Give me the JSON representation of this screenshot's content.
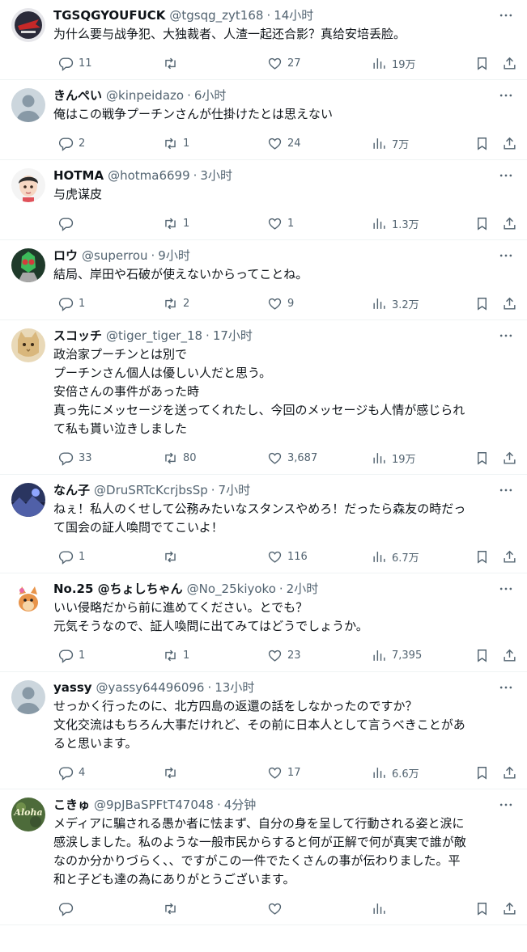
{
  "tweets": [
    {
      "name": "TGSQGYOUFUCK",
      "handle": "@tgsqg_zyt168",
      "time": "14小时",
      "lines": [
        "为什么要与战争犯、大独裁者、人渣一起还合影？真给安培丢脸。"
      ],
      "replies": "11",
      "retweets": "",
      "likes": "27",
      "views": "19万",
      "avatar": {
        "kind": "logo",
        "bg": "#2b2b3a",
        "fg": "#c62828"
      }
    },
    {
      "name": "きんぺい",
      "handle": "@kinpeidazo",
      "time": "6小时",
      "lines": [
        "俺はこの戦争プーチンさんが仕掛けたとは思えない"
      ],
      "replies": "2",
      "retweets": "1",
      "likes": "24",
      "views": "7万",
      "avatar": {
        "kind": "default",
        "bg": "#ccd6dd",
        "fg": "#8899a6"
      }
    },
    {
      "name": "HOTMA",
      "handle": "@hotma6699",
      "time": "3小时",
      "lines": [
        "与虎谋皮"
      ],
      "replies": "",
      "retweets": "1",
      "likes": "1",
      "views": "1.3万",
      "avatar": {
        "kind": "face",
        "bg": "#f4f4f4",
        "fg": "#2b2b2b"
      }
    },
    {
      "name": "ロウ",
      "handle": "@superrou",
      "time": "9小时",
      "lines": [
        "結局、岸田や石破が使えないからってことね。"
      ],
      "replies": "1",
      "retweets": "2",
      "likes": "9",
      "views": "3.2万",
      "avatar": {
        "kind": "hero",
        "bg": "#1f3a2a",
        "fg": "#3dbb5a"
      }
    },
    {
      "name": "スコッチ",
      "handle": "@tiger_tiger_18",
      "time": "17小时",
      "lines": [
        "政治家プーチンとは別で",
        "プーチンさん個人は優しい人だと思う。",
        "安倍さんの事件があった時",
        "真っ先にメッセージを送ってくれたし、今回のメッセージも人情が感じられ",
        "て私も貰い泣きしました"
      ],
      "replies": "33",
      "retweets": "80",
      "likes": "3,687",
      "views": "19万",
      "avatar": {
        "kind": "cat",
        "bg": "#d9b77c",
        "fg": "#8a6a3a"
      }
    },
    {
      "name": "なん子",
      "handle": "@DruSRTcKcrjbsSp",
      "time": "7小时",
      "lines": [
        "ねぇ！私人のくせして公務みたいなスタンスやめろ！だったら森友の時だっ",
        "て国会の証人喚問でてこいよ！"
      ],
      "replies": "1",
      "retweets": "",
      "likes": "116",
      "views": "6.7万",
      "avatar": {
        "kind": "scene",
        "bg": "#2a3560",
        "fg": "#8fa6ff"
      }
    },
    {
      "name": "No.25 @ちょしちゃん",
      "handle": "@No_25kiyoko",
      "time": "2小时",
      "lines": [
        "いい侵略だから前に進めてください。とでも？",
        "元気そうなので、証人喚問に出てみてはどうでしょうか。"
      ],
      "replies": "1",
      "retweets": "1",
      "likes": "23",
      "views": "7,395",
      "avatar": {
        "kind": "animal",
        "bg": "#ffffff",
        "fg": "#e8944a"
      }
    },
    {
      "name": "yassy",
      "handle": "@yassy64496096",
      "time": "13小时",
      "lines": [
        "せっかく行ったのに、北方四島の返還の話をしなかったのですか？",
        "文化交流はもちろん大事だけれど、その前に日本人として言うべきことがあ",
        "ると思います。"
      ],
      "replies": "4",
      "retweets": "",
      "likes": "17",
      "views": "6.6万",
      "avatar": {
        "kind": "default",
        "bg": "#ccd6dd",
        "fg": "#8899a6"
      }
    },
    {
      "name": "こきゅ",
      "handle": "@9pJBaSPFtT47048",
      "time": "4分钟",
      "lines": [
        "メディアに騙される愚か者に怯まず、自分の身を呈して行動される姿と涙に",
        "感涙しました。私のような一般市民からすると何が正解で何が真実で誰が敵",
        "なのか分かりづらく、、ですがこの一件でたくさんの事が伝わりました。平",
        "和と子ども達の為にありがとうございます。"
      ],
      "replies": "",
      "retweets": "",
      "likes": "",
      "views": "",
      "avatar": {
        "kind": "aloha",
        "bg": "#4d6b3a",
        "fg": "#f2f2d0",
        "text": "Aloha"
      }
    }
  ],
  "icons": {
    "reply": "reply-icon",
    "retweet": "retweet-icon",
    "like": "heart-icon",
    "views": "views-icon",
    "bookmark": "bookmark-icon",
    "share": "share-icon",
    "more": "more-icon"
  },
  "colors": {
    "text": "#0f1419",
    "muted": "#536471",
    "divider": "#eff3f4"
  }
}
